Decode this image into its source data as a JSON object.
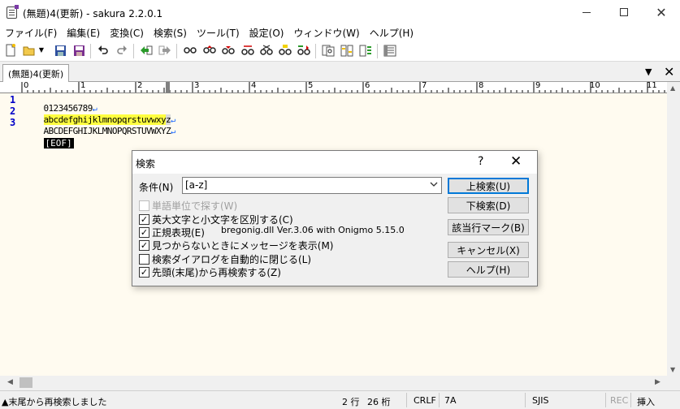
{
  "window": {
    "title": "(無題)4(更新) - sakura 2.2.0.1",
    "min_glyph": "—",
    "close_glyph": "✕"
  },
  "menu": [
    "ファイル(F)",
    "編集(E)",
    "変換(C)",
    "検索(S)",
    "ツール(T)",
    "設定(O)",
    "ウィンドウ(W)",
    "ヘルプ(H)"
  ],
  "toolbar": {
    "icons": [
      "new-file-icon",
      "open-folder-icon",
      "dropdown-arrow-icon",
      "save-icon",
      "save-all-icon",
      "undo-icon",
      "redo-icon",
      "jump-back-icon",
      "jump-forward-icon",
      "search-icon",
      "search-prev-icon",
      "search-next-icon",
      "replace-icon",
      "mark-icon",
      "mark-next-icon",
      "mark-prev-icon",
      "grep-icon",
      "compare-icon",
      "outline-icon",
      "settings-icon"
    ]
  },
  "tab": {
    "label": "(無題)4(更新)",
    "menu_glyph": "▼",
    "close_glyph": "✕"
  },
  "ruler": {
    "labels": [
      "0",
      "1",
      "2",
      "3",
      "4",
      "5",
      "6",
      "7",
      "8",
      "9",
      "10",
      "11"
    ]
  },
  "editor": {
    "line_numbers": [
      "1",
      "2",
      "3"
    ],
    "lines": {
      "l1": "0123456789",
      "l2_main": "abcdefghijklmnopqrstuvwxy",
      "l2_cursor": "z",
      "l3": "ABCDEFGHIJKLMNOPQRSTUVWXYZ"
    },
    "eol_mark": "↵",
    "eof": "[EOF]"
  },
  "dialog": {
    "title": "検索",
    "help_glyph": "?",
    "close_glyph": "✕",
    "condition_label": "条件(N)",
    "condition_value": "[a-z]",
    "checkboxes": [
      {
        "label": "単語単位で探す(W)",
        "checked": false,
        "enabled": false
      },
      {
        "label": "英大文字と小文字を区別する(C)",
        "checked": true,
        "enabled": true
      },
      {
        "label": "正規表現(E)",
        "checked": true,
        "enabled": true
      },
      {
        "label": "見つからないときにメッセージを表示(M)",
        "checked": true,
        "enabled": true
      },
      {
        "label": "検索ダイアログを自動的に閉じる(L)",
        "checked": false,
        "enabled": true
      },
      {
        "label": "先頭(末尾)から再検索する(Z)",
        "checked": true,
        "enabled": true
      }
    ],
    "regex_library": "bregonig.dll Ver.3.06 with Onigmo 5.15.0",
    "buttons": [
      "上検索(U)",
      "下検索(D)",
      "該当行マーク(B)",
      "キャンセル(X)",
      "ヘルプ(H)"
    ]
  },
  "status": {
    "message": "▲末尾から再検索しました",
    "line": "2 行",
    "column": "26 桁",
    "newline": "CRLF",
    "char_code": "7A",
    "encoding": "SJIS",
    "rec": "REC",
    "mode": "挿入"
  },
  "colors": {
    "editor_background": "#fffbf0",
    "highlight": "#ffff40",
    "line_number": "#0000c8",
    "eol_mark": "#1060ff",
    "default_button_border": "#0078d7"
  }
}
